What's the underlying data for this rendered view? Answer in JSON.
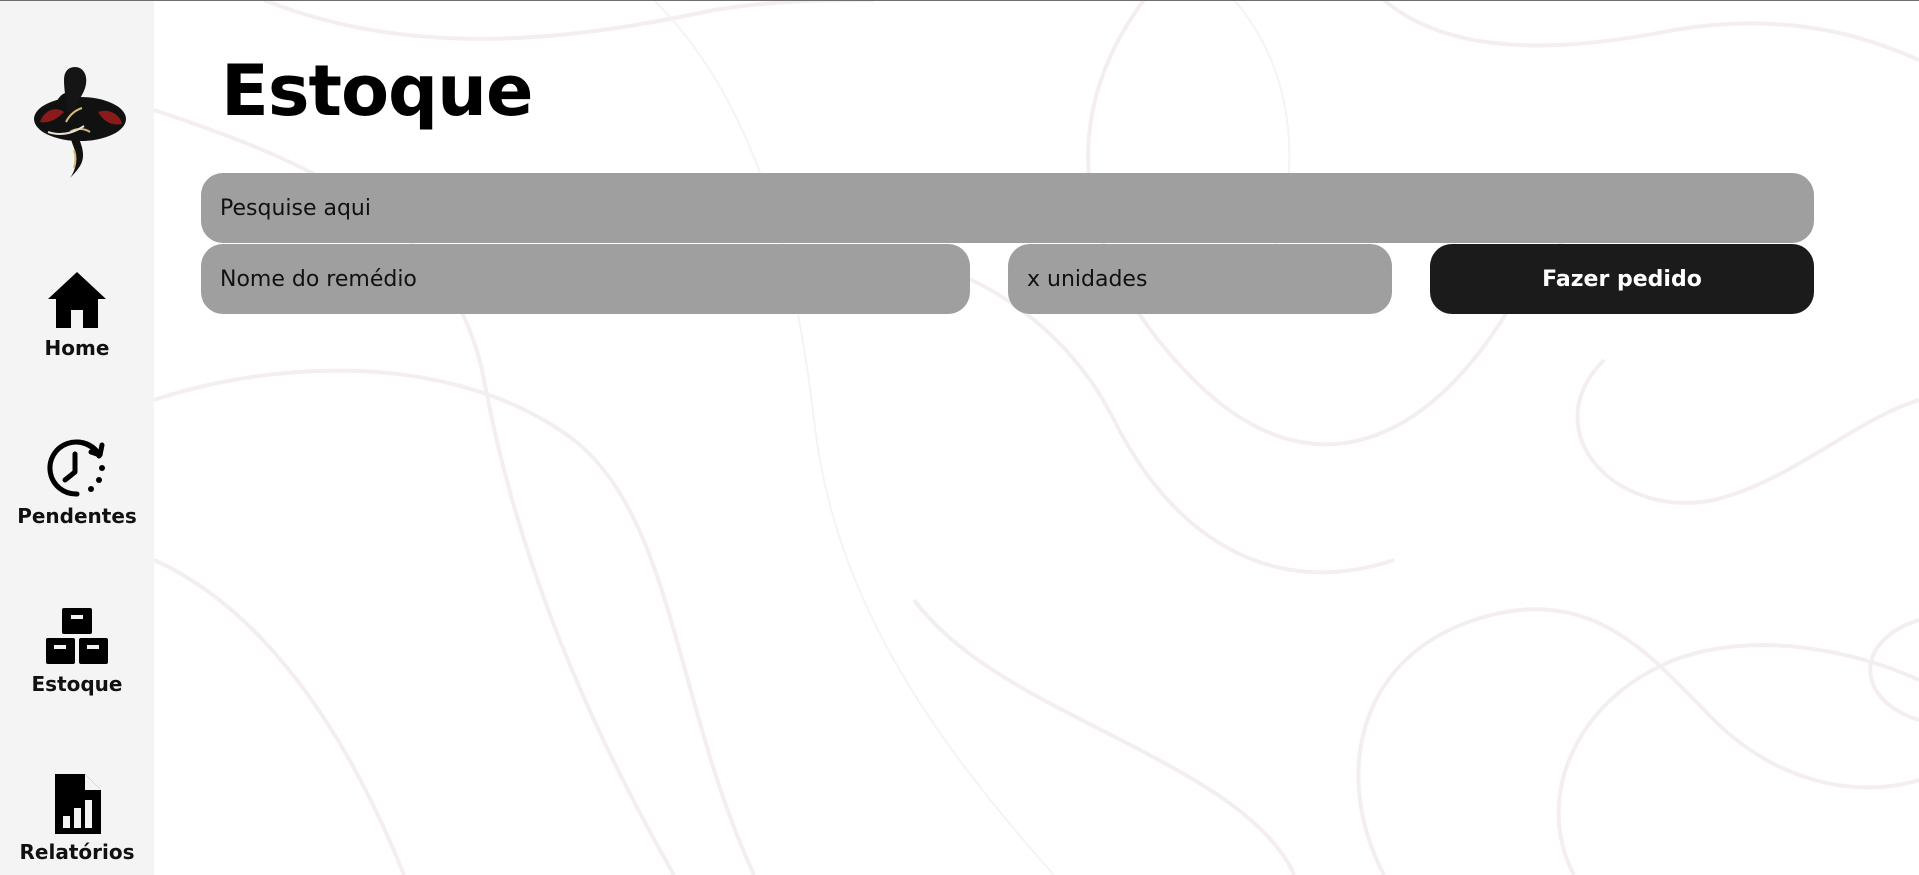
{
  "page": {
    "title": "Estoque"
  },
  "sidebar": {
    "logo_icon": "snake-logo-icon",
    "items": [
      {
        "label": "Home",
        "icon": "home-icon"
      },
      {
        "label": "Pendentes",
        "icon": "clock-pending-icon"
      },
      {
        "label": "Estoque",
        "icon": "boxes-icon"
      },
      {
        "label": "Relatórios",
        "icon": "report-file-icon"
      }
    ]
  },
  "search": {
    "placeholder": "Pesquise aqui",
    "value": ""
  },
  "order_form": {
    "medicine_placeholder": "Nome do remédio",
    "medicine_value": "",
    "quantity_placeholder": "x unidades",
    "quantity_value": "",
    "submit_label": "Fazer pedido"
  },
  "colors": {
    "sidebar_bg": "#f4f4f4",
    "input_bg": "#a09fa0",
    "button_bg": "#1b1b1b",
    "button_text": "#ffffff",
    "logo_accent": "#8b1a1a",
    "logo_gold": "#d4b87a"
  }
}
